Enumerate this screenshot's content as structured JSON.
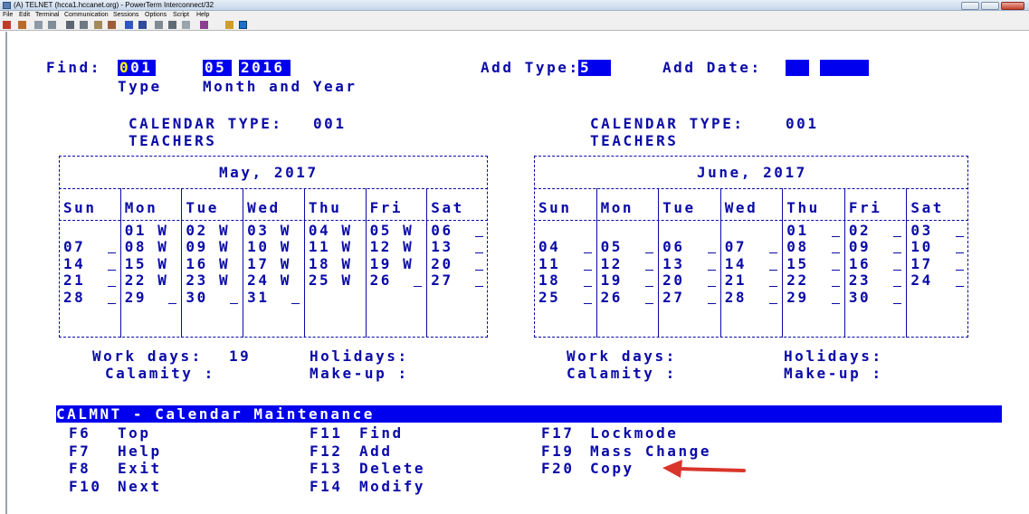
{
  "window": {
    "title": "(A) TELNET (hcca1.hccanet.org) - PowerTerm Interconnect/32"
  },
  "menu": [
    "File",
    "Edit",
    "Terminal",
    "Communication",
    "Sessions",
    "Options",
    "Script",
    "Help"
  ],
  "header": {
    "find_label": "Find:",
    "type_value": "001",
    "cursor_char": "0",
    "type_rest": "01",
    "month_value": "05",
    "year_value": "2016",
    "type_caption": "Type",
    "month_year_caption": "Month and Year",
    "add_type_label": "Add Type:",
    "add_type_value": "5",
    "add_date_label": "Add Date:"
  },
  "calendars": [
    {
      "type_label": "CALENDAR TYPE:",
      "type_code": "001",
      "type_name": "TEACHERS",
      "title": "May, 2017",
      "days": [
        "Sun",
        "Mon",
        "Tue",
        "Wed",
        "Thu",
        "Fri",
        "Sat"
      ],
      "weeks": [
        [
          "",
          "01 W",
          "02 W",
          "03 W",
          "04 W",
          "05 W",
          "06"
        ],
        [
          "07",
          "08 W",
          "09 W",
          "10 W",
          "11 W",
          "12 W",
          "13"
        ],
        [
          "14",
          "15 W",
          "16 W",
          "17 W",
          "18 W",
          "19 W",
          "20"
        ],
        [
          "21",
          "22 W",
          "23 W",
          "24 W",
          "25 W",
          "26",
          "27"
        ],
        [
          "28",
          "29",
          "30",
          "31",
          "",
          "",
          ""
        ]
      ],
      "work_days_label": "Work days:",
      "work_days_value": "19",
      "holidays_label": "Holidays:",
      "calamity_label": "Calamity :",
      "makeup_label": "Make-up :"
    },
    {
      "type_label": "CALENDAR TYPE:",
      "type_code": "001",
      "type_name": "TEACHERS",
      "title": "June, 2017",
      "days": [
        "Sun",
        "Mon",
        "Tue",
        "Wed",
        "Thu",
        "Fri",
        "Sat"
      ],
      "weeks": [
        [
          "",
          "",
          "",
          "",
          "01",
          "02",
          "03"
        ],
        [
          "04",
          "05",
          "06",
          "07",
          "08",
          "09",
          "10"
        ],
        [
          "11",
          "12",
          "13",
          "14",
          "15",
          "16",
          "17"
        ],
        [
          "18",
          "19",
          "20",
          "21",
          "22",
          "23",
          "24"
        ],
        [
          "25",
          "26",
          "27",
          "28",
          "29",
          "30",
          ""
        ]
      ],
      "work_days_label": "Work days:",
      "work_days_value": "",
      "holidays_label": "Holidays:",
      "calamity_label": "Calamity :",
      "makeup_label": "Make-up :"
    }
  ],
  "screen_title": "CALMNT - Calendar Maintenance",
  "function_keys": [
    {
      "key": "F6",
      "label": "Top"
    },
    {
      "key": "F7",
      "label": "Help"
    },
    {
      "key": "F8",
      "label": "Exit"
    },
    {
      "key": "F10",
      "label": "Next"
    },
    {
      "key": "F11",
      "label": "Find"
    },
    {
      "key": "F12",
      "label": "Add"
    },
    {
      "key": "F13",
      "label": "Delete"
    },
    {
      "key": "F14",
      "label": "Modify"
    },
    {
      "key": "F17",
      "label": "Lockmode"
    },
    {
      "key": "F19",
      "label": "Mass Change"
    },
    {
      "key": "F20",
      "label": "Copy"
    }
  ],
  "colors": {
    "terminal_text": "#0a0aa8",
    "field_bg": "#0000ee",
    "arrow": "#d9352b"
  }
}
